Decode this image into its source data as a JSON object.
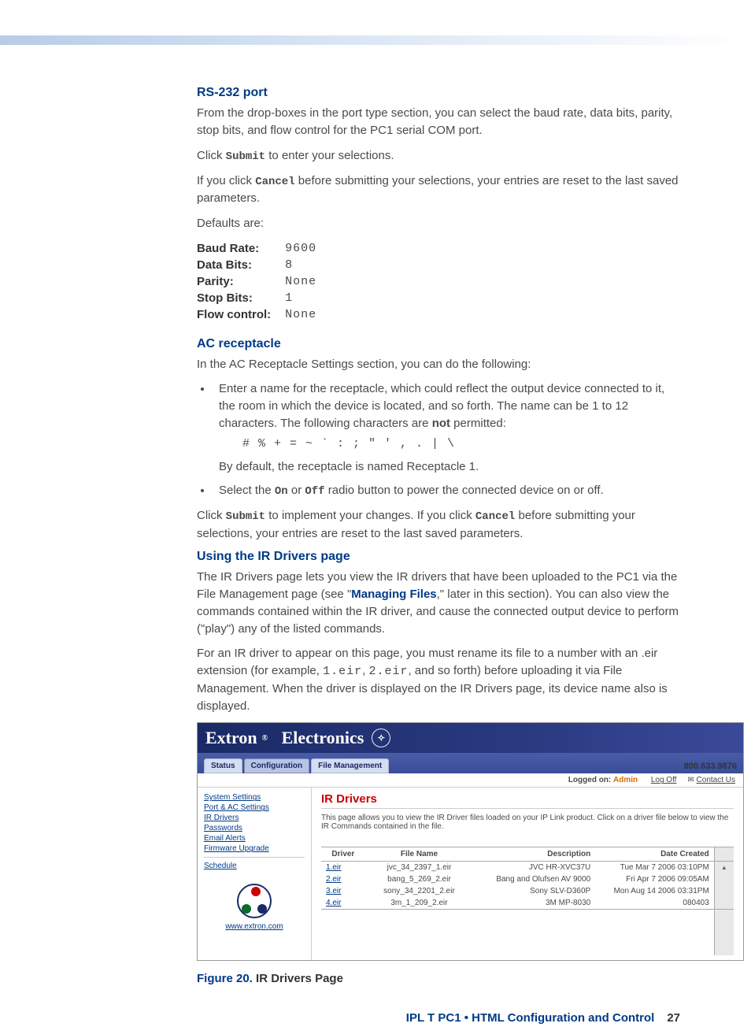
{
  "sections": {
    "rs232": {
      "heading": "RS-232 port",
      "p1": "From the drop-boxes in the port type section, you can select the baud rate, data bits, parity, stop bits, and flow control for the PC1 serial COM port.",
      "p2_prefix": "Click ",
      "p2_code": "Submit",
      "p2_suffix": " to enter your selections.",
      "p3_prefix": "If you click ",
      "p3_code": "Cancel",
      "p3_suffix": " before submitting your selections, your entries are reset to the last saved parameters.",
      "p4": "Defaults are:",
      "defaults": {
        "baud_label": "Baud Rate:",
        "baud_value": "9600",
        "data_label": "Data Bits:",
        "data_value": "8",
        "parity_label": "Parity:",
        "parity_value": "None",
        "stop_label": "Stop Bits:",
        "stop_value": "1",
        "flow_label": "Flow control:",
        "flow_value": "None"
      }
    },
    "ac": {
      "heading": "AC receptacle",
      "p1": "In the AC Receptacle Settings section, you can do the following:",
      "li1_a": "Enter a name for the receptacle, which could reflect the output device connected to it, the room in which the device is located, and so forth. The name can be 1 to 12 characters. The following characters are ",
      "li1_not": "not",
      "li1_b": " permitted:",
      "chars": "# % + = ~ ` : ; \" ' , . | \\",
      "li1_c": "By default, the receptacle is named Receptacle 1.",
      "li2_a": "Select the ",
      "li2_on": "On",
      "li2_or": " or ",
      "li2_off": "Off",
      "li2_b": " radio button to power the connected device on or off.",
      "p2_a": "Click ",
      "p2_submit": "Submit",
      "p2_b": " to implement your changes. If you click ",
      "p2_cancel": "Cancel",
      "p2_c": " before submitting your selections, your entries are reset to the last saved parameters."
    },
    "ir": {
      "heading": "Using the IR Drivers page",
      "p1_a": "The IR Drivers page lets you view the IR drivers that have been uploaded to the PC1 via the File Management page (see \"",
      "p1_link": "Managing Files",
      "p1_b": ",\" later in this section). You can also view the commands contained within the IR driver, and cause the connected output device to perform (\"play\") any of the listed commands.",
      "p2_a": "For an IR driver to appear on this page, you must rename its file to a number with an .eir extension (for example, ",
      "p2_m1": "1.eir",
      "p2_b": ", ",
      "p2_m2": "2.eir",
      "p2_c": ", and so forth) before uploading it via File Management. When the driver is displayed on the IR Drivers page, its device name also is displayed."
    }
  },
  "screenshot": {
    "banner": {
      "brand_a": "Extron",
      "brand_b": "Electronics"
    },
    "tabs": {
      "status": "Status",
      "config": "Configuration",
      "filemgmt": "File Management"
    },
    "phone": "800.633.9876",
    "actions": {
      "logged_on_label": "Logged on:",
      "logged_on_user": "Admin",
      "logoff": "Log Off",
      "contact": "Contact Us"
    },
    "sidebar": {
      "items": [
        "System Settings",
        "Port & AC Settings",
        "IR Drivers",
        "Passwords",
        "Email Alerts",
        "Firmware Upgrade"
      ],
      "schedule": "Schedule",
      "url": "www.extron.com"
    },
    "main": {
      "title": "IR Drivers",
      "desc": "This page allows you to view the IR Driver files loaded on your IP Link product. Click on a driver file below to view the IR Commands contained in the file.",
      "cols": {
        "c1": "Driver",
        "c2": "File Name",
        "c3": "Description",
        "c4": "Date Created"
      },
      "rows": [
        {
          "driver": "1.eir",
          "file": "jvc_34_2397_1.eir",
          "desc": "JVC HR-XVC37U",
          "date": "Tue Mar 7 2006 03:10PM"
        },
        {
          "driver": "2.eir",
          "file": "bang_5_269_2.eir",
          "desc": "Bang and Olufsen AV 9000",
          "date": "Fri Apr 7 2006 09:05AM"
        },
        {
          "driver": "3.eir",
          "file": "sony_34_2201_2.eir",
          "desc": "Sony SLV-D360P",
          "date": "Mon Aug 14 2006 03:31PM"
        },
        {
          "driver": "4.eir",
          "file": "3m_1_209_2.eir",
          "desc": "3M MP-8030",
          "date": "080403"
        }
      ]
    }
  },
  "figure": {
    "label": "Figure 20.",
    "text": "IR Drivers Page"
  },
  "footer": {
    "text": "IPL T PC1 • HTML Configuration and Control",
    "page": "27"
  }
}
